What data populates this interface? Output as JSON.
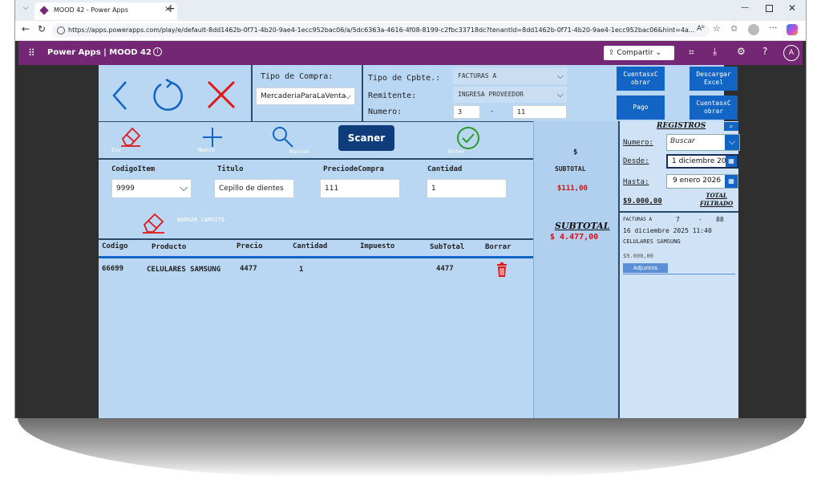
{
  "browser": {
    "tab_title": "MOOD 42 - Power Apps",
    "url": "https://apps.powerapps.com/play/e/default-8dd1462b-0f71-4b20-9ae4-1ecc952bac06/a/5dc6363a-4616-4f08-8199-c2fbc33718dc?tenantId=8dd1462b-0f71-4b20-9ae4-1ecc952bac06&hint=4a..."
  },
  "powerapps": {
    "brand": "Power Apps",
    "separator": "|",
    "app_name": "MOOD 42",
    "share_label": "Compartir",
    "avatar_initial": "A"
  },
  "form": {
    "tipo_compra_label": "Tipo de Compra:",
    "tipo_compra_value": "MercaderiaParaLaVenta",
    "tipo_cpbte_label": "Tipo de Cpbte.:",
    "tipo_cpbte_value": "FACTURAS A",
    "remitente_label": "Remitente:",
    "remitente_value": "INGRESA PROVEEDOR",
    "numero_label": "Numero:",
    "numero_prefix": "3",
    "numero_dash": "-",
    "numero_value": "11"
  },
  "buttons": {
    "cuentasx_cobrar_1": "CuentasxC obrar",
    "descargar_excel": "Descargar Excel",
    "pago": "Pago",
    "cuentasx_cobrar_2": "CuentasxC obrar",
    "scaner": "Scaner",
    "esc": "Esc",
    "nuevo": "Nuevo",
    "buscar": "Buscar",
    "enter": "Enter",
    "borrar_carrito": "BORRAR CARRITO"
  },
  "item_entry": {
    "codigo_label": "CodigoItem",
    "codigo_value": "9999",
    "titulo_label": "Titulo",
    "titulo_value": "Cepillo de dientes",
    "precio_label": "PreciodeCompra",
    "precio_value": "111",
    "cantidad_label": "Cantidad",
    "cantidad_value": "1"
  },
  "table": {
    "headers": [
      "Codigo",
      "Producto",
      "Precio",
      "Cantidad",
      "Impuesto",
      "SubTotal",
      "Borrar"
    ],
    "rows": [
      {
        "codigo": "66699",
        "producto": "CELULARES SAMSUNG",
        "precio": "4477",
        "cantidad": "1",
        "impuesto": "",
        "subtotal": "4477"
      }
    ]
  },
  "totals": {
    "currency": "$",
    "subtotal_label": "SUBTOTAL",
    "subtotal_item": "$111,00",
    "subtotal_big_label": "SUBTOTAL",
    "subtotal_big_value": "$ 4.477,00"
  },
  "registros": {
    "title": "REGISTROS",
    "numero_label": "Numero:",
    "numero_placeholder": "Buscar",
    "desde_label": "Desde:",
    "desde_value": "1 diciembre 20",
    "hasta_label": "Hasta:",
    "hasta_value": "9 enero 2026",
    "total_value": "$9.000,00",
    "total_label_1": "TOTAL",
    "total_label_2": "FILTRADO",
    "entry": {
      "tipo": "FACTURAS A",
      "num1": "7",
      "dash": "-",
      "num2": "88",
      "fecha": "16 diciembre 2025 11:40",
      "remitente": "CELULARES SAMSUNG",
      "monto": "$9.000,00",
      "adjuntos": "Adjuntos"
    }
  },
  "colors": {
    "powerapps_purple": "#742774",
    "canvas_blue": "#b9d6f2",
    "accent_blue": "#1365c5",
    "danger_red": "#e01818",
    "total_red": "#d41010",
    "ok_green": "#2e9a2e"
  }
}
